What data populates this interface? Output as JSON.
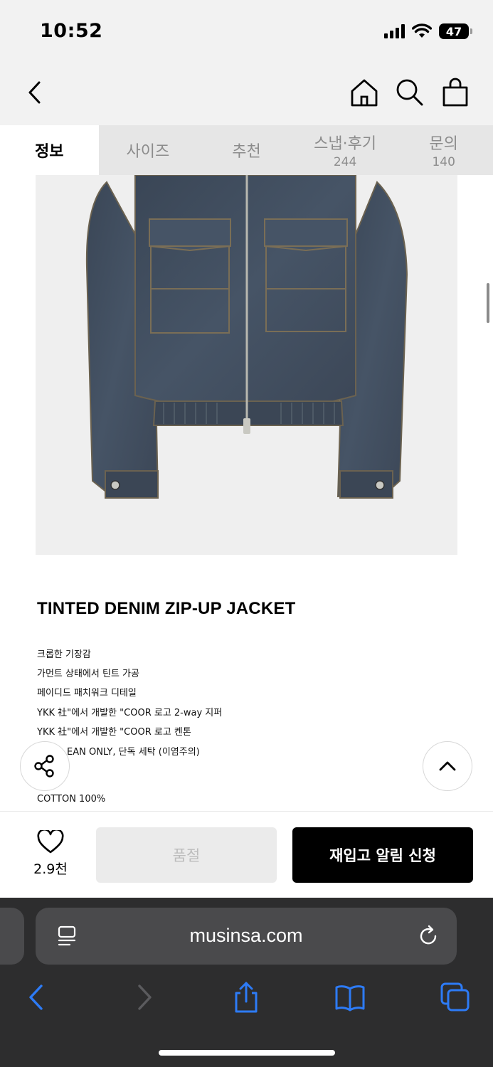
{
  "status_bar": {
    "time": "10:52",
    "battery": "47"
  },
  "tabs": [
    {
      "label": "정보",
      "count": ""
    },
    {
      "label": "사이즈",
      "count": ""
    },
    {
      "label": "추천",
      "count": ""
    },
    {
      "label": "스냅·후기",
      "count": "244"
    },
    {
      "label": "문의",
      "count": "140"
    }
  ],
  "product": {
    "title": "TINTED DENIM ZIP-UP JACKET",
    "details": [
      "크롭한 기장감",
      "가먼트 상태에서 틴트 가공",
      "페이디드 패치워크 디테일",
      "YKK 社\"에서 개발한 \"COOR 로고 2-way 지퍼",
      "YKK 社\"에서 개발한 \"COOR 로고 켄톤",
      "EAN ONLY, 단독 세탁 (이염주의)",
      "COTTON 100%"
    ]
  },
  "buy_bar": {
    "like_count": "2.9천",
    "soldout_label": "품절",
    "restock_label": "재입고 알림 신청"
  },
  "browser": {
    "url": "musinsa.com"
  },
  "colors": {
    "restock_button": "#000000",
    "soldout_button": "#ebebeb",
    "safari_tint": "#2d7bf6",
    "tab_bg": "#e6e6e6"
  }
}
